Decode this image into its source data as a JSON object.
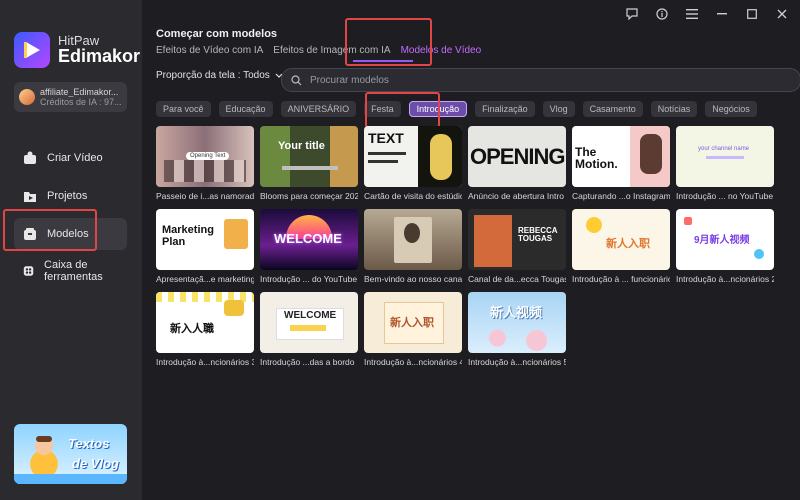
{
  "brand": {
    "name_top": "HitPaw",
    "name_bottom": "Edimakor"
  },
  "account": {
    "username": "affiliate_Edimakor...",
    "credits": "Créditos de IA : 97..."
  },
  "nav": [
    {
      "label": "Criar Vídeo",
      "icon": "create-video-icon"
    },
    {
      "label": "Projetos",
      "icon": "projects-icon"
    },
    {
      "label": "Modelos",
      "icon": "templates-icon"
    },
    {
      "label": "Caixa de ferramentas",
      "icon": "toolbox-icon"
    }
  ],
  "promo": {
    "line1": "Textos",
    "line2": "de Vlog"
  },
  "header": {
    "title": "Começar com modelos",
    "tabs": [
      "Efeitos de Vídeo com IA",
      "Efeitos de Imagem com IA",
      "Modelos de Vídeo"
    ]
  },
  "filter": {
    "ratio_label": "Proporção da tela : Todos",
    "search_placeholder": "Procurar modelos"
  },
  "categories": [
    "Para você",
    "Educação",
    "ANIVERSÁRIO",
    "Festa",
    "Introdução",
    "Finalização",
    "Vlog",
    "Casamento",
    "Notícias",
    "Negócios"
  ],
  "templates": [
    {
      "caption": "Passeio de i...as namoradas",
      "thumb_text": "Opening Text"
    },
    {
      "caption": "Blooms para começar 2025",
      "thumb_text": "Your title"
    },
    {
      "caption": "Cartão de visita do estúdio",
      "thumb_text": "TEXT"
    },
    {
      "caption": "Anúncio de abertura Intro",
      "thumb_text": "OPENING"
    },
    {
      "caption": "Capturando ...o Instagram",
      "thumb_text": "The Motion."
    },
    {
      "caption": "Introdução ... no YouTube",
      "thumb_text": "your channel name"
    },
    {
      "caption": "Apresentaçã...e marketing",
      "thumb_text": "Marketing Plan"
    },
    {
      "caption": "Introdução ... do YouTube",
      "thumb_text": "WELCOME"
    },
    {
      "caption": "Bem-vindo ao nosso canal",
      "thumb_text": ""
    },
    {
      "caption": "Canal de da...ecca Tougas",
      "thumb_text": "REBECCA TOUGAS"
    },
    {
      "caption": "Introdução à ... funcionários",
      "thumb_text": "新人入职"
    },
    {
      "caption": "Introdução à...ncionários 2",
      "thumb_text": "9月新人视频"
    },
    {
      "caption": "Introdução à...ncionários 3",
      "thumb_text": "新入人職"
    },
    {
      "caption": "Introdução ...das a bordo",
      "thumb_text": "WELCOME"
    },
    {
      "caption": "Introdução à...ncionários 4",
      "thumb_text": "新人入职"
    },
    {
      "caption": "Introdução à...ncionários 5",
      "thumb_text": "新人视频"
    }
  ],
  "colors": {
    "accent": "#9a55ff",
    "highlight": "#e04646",
    "background": "#1e1e22",
    "sidebar": "#2a2a2f"
  }
}
